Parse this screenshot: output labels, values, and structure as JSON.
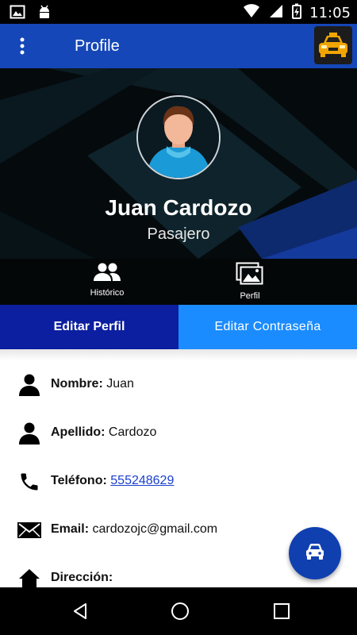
{
  "status_bar": {
    "time": "11:05",
    "left_icons": [
      "image-notification-icon",
      "android-debug-icon"
    ],
    "right_icons": [
      "wifi-icon",
      "cell-signal-icon",
      "battery-charging-icon"
    ]
  },
  "app_bar": {
    "title": "Profile",
    "menu_icon": "more-vert-icon",
    "logo_icon": "taxi-logo"
  },
  "profile": {
    "name": "Juan Cardozo",
    "role": "Pasajero"
  },
  "hero_tabs": [
    {
      "label": "Histórico",
      "icon": "people-icon"
    },
    {
      "label": "Perfil",
      "icon": "photos-icon"
    }
  ],
  "actions": {
    "edit_profile": "Editar Perfil",
    "edit_password": "Editar Contraseña"
  },
  "details": [
    {
      "label": "Nombre:",
      "value": "Juan",
      "icon": "person-icon"
    },
    {
      "label": "Apellido:",
      "value": "Cardozo",
      "icon": "person-icon"
    },
    {
      "label": "Teléfono:",
      "value": "555248629",
      "icon": "phone-icon"
    },
    {
      "label": "Email:",
      "value": "cardozojc@gmail.com",
      "icon": "mail-icon"
    },
    {
      "label": "Dirección:",
      "value": "",
      "icon": "home-icon"
    }
  ],
  "fab": {
    "icon": "car-icon"
  },
  "nav": [
    "back-icon",
    "home-circle-icon",
    "recents-icon"
  ],
  "colors": {
    "app_bar": "#1547b8",
    "edit_profile_bg": "#0b1fa0",
    "edit_password_bg": "#1a8cff",
    "fab": "#1040b0",
    "link": "#1a3fcf"
  }
}
